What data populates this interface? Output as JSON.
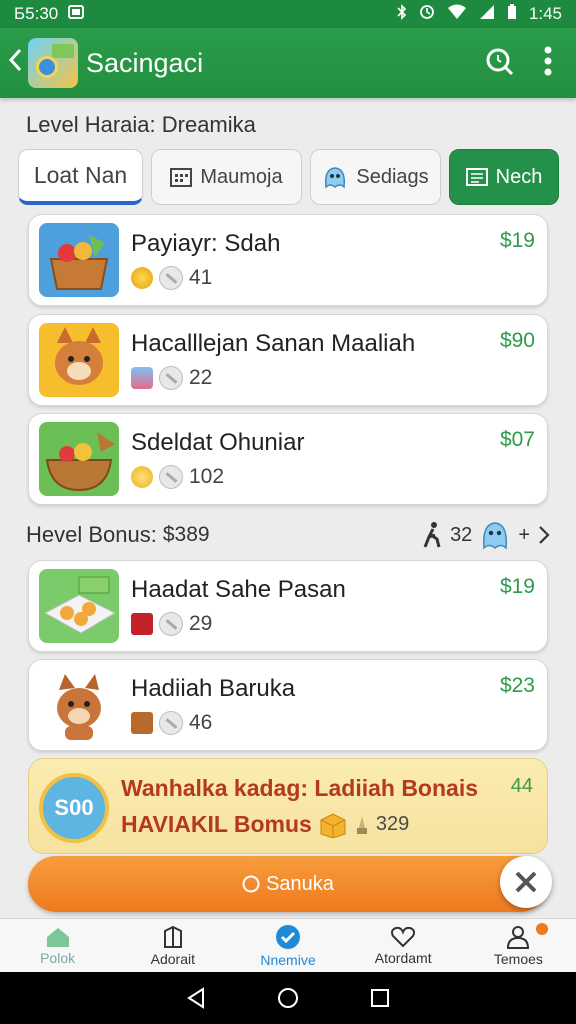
{
  "status": {
    "time_left": "Б5:30",
    "time_right": "1:45"
  },
  "appbar": {
    "title": "Sacingaci"
  },
  "section": {
    "title": "Level Haraia: Dreamika"
  },
  "tabs": [
    {
      "label": "Loat Nan"
    },
    {
      "label": "Maumoja"
    },
    {
      "label": "Sediags"
    },
    {
      "label": "Nech"
    }
  ],
  "items": [
    {
      "name": "Payiayr: Sdah",
      "count": "41",
      "price": "$19"
    },
    {
      "name": "Hacalllejan Sanan Maaliah",
      "count": "22",
      "price": "$90"
    },
    {
      "name": "Sdeldat Ohuniar",
      "count": "102",
      "price": "$07"
    }
  ],
  "bonus": {
    "label": "Hevel Bonus:",
    "amount": "$389",
    "count": "32",
    "plus": "+"
  },
  "items2": [
    {
      "name": "Haadat Sahe Pasan",
      "count": "29",
      "price": "$19"
    },
    {
      "name": "Hadiiah Baruka",
      "count": "46",
      "price": "$23"
    }
  ],
  "promo": {
    "badge": "S00",
    "line1": "Wanhalka kadag: Ladiiah Bonais",
    "line2": "HAVIAKIL Bomus",
    "line2_num": "329",
    "corner": "44"
  },
  "cta": {
    "label": "Sanuka"
  },
  "nav": [
    {
      "label": "Polok"
    },
    {
      "label": "Adorait"
    },
    {
      "label": "Nnemive"
    },
    {
      "label": "Atordamt"
    },
    {
      "label": "Temoes"
    }
  ],
  "colors": {
    "brand": "#24914a",
    "accent": "#ee7a1e",
    "price": "#2e9a4b"
  }
}
